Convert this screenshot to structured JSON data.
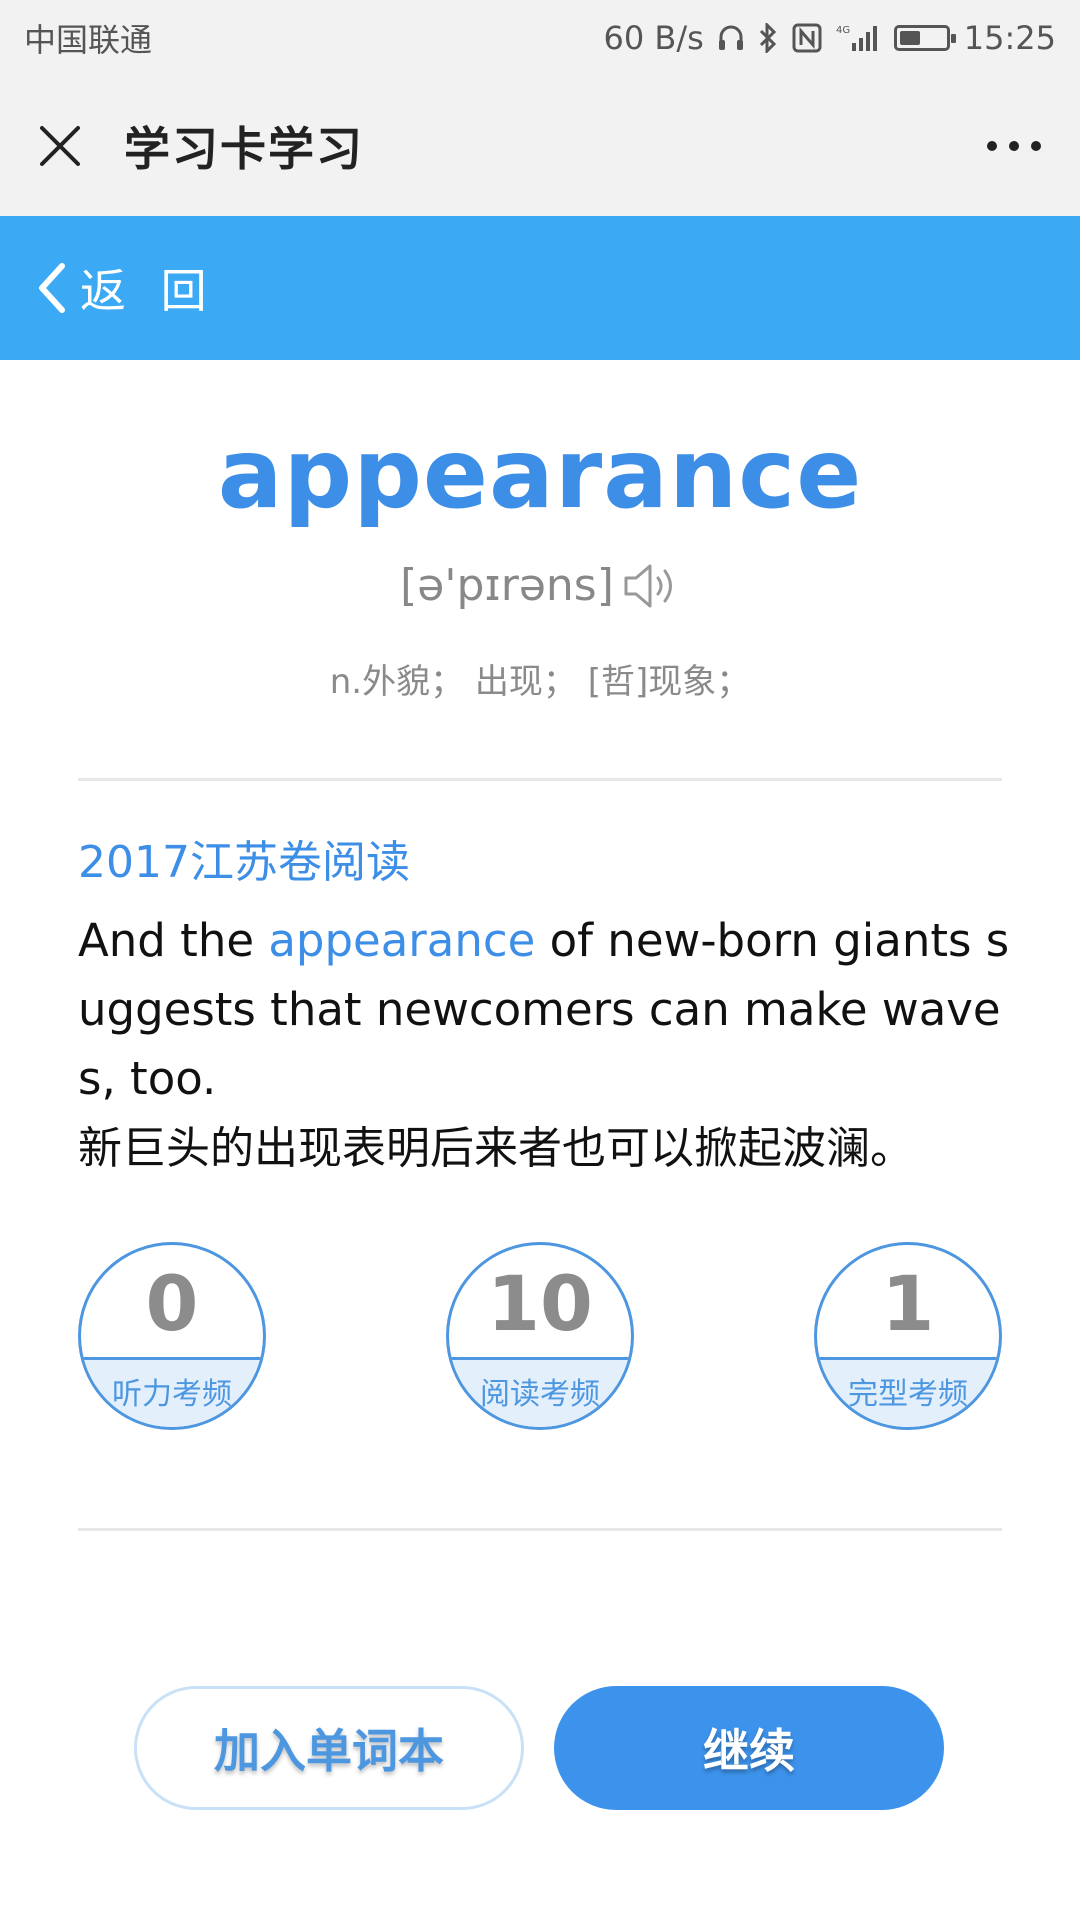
{
  "status_bar": {
    "carrier": "中国联通",
    "speed": "60 B/s",
    "network": "4G",
    "time": "15:25",
    "battery_level": 0.45
  },
  "title_bar": {
    "title": "学习卡学习",
    "close_icon": "close-icon",
    "more_icon": "more-icon"
  },
  "header": {
    "back_label": "返 回"
  },
  "word": {
    "text": "appearance",
    "phonetic": "[ə'pɪrəns]",
    "definition": "n.外貌； 出现； [哲]现象；"
  },
  "example": {
    "source": "2017江苏卷阅读",
    "sentence_before": "And the ",
    "sentence_highlight": "appearance",
    "sentence_after": " of new-born giants suggests that newcomers can make waves, too.",
    "translation": "新巨头的出现表明后来者也可以掀起波澜。"
  },
  "stats": [
    {
      "value": "0",
      "label": "听力考频"
    },
    {
      "value": "10",
      "label": "阅读考频"
    },
    {
      "value": "1",
      "label": "完型考频"
    }
  ],
  "buttons": {
    "add_label": "加入单词本",
    "continue_label": "继续"
  },
  "colors": {
    "accent": "#3d8ee6",
    "header_bg": "#3ba9f3",
    "button_primary": "#3d93ec"
  }
}
